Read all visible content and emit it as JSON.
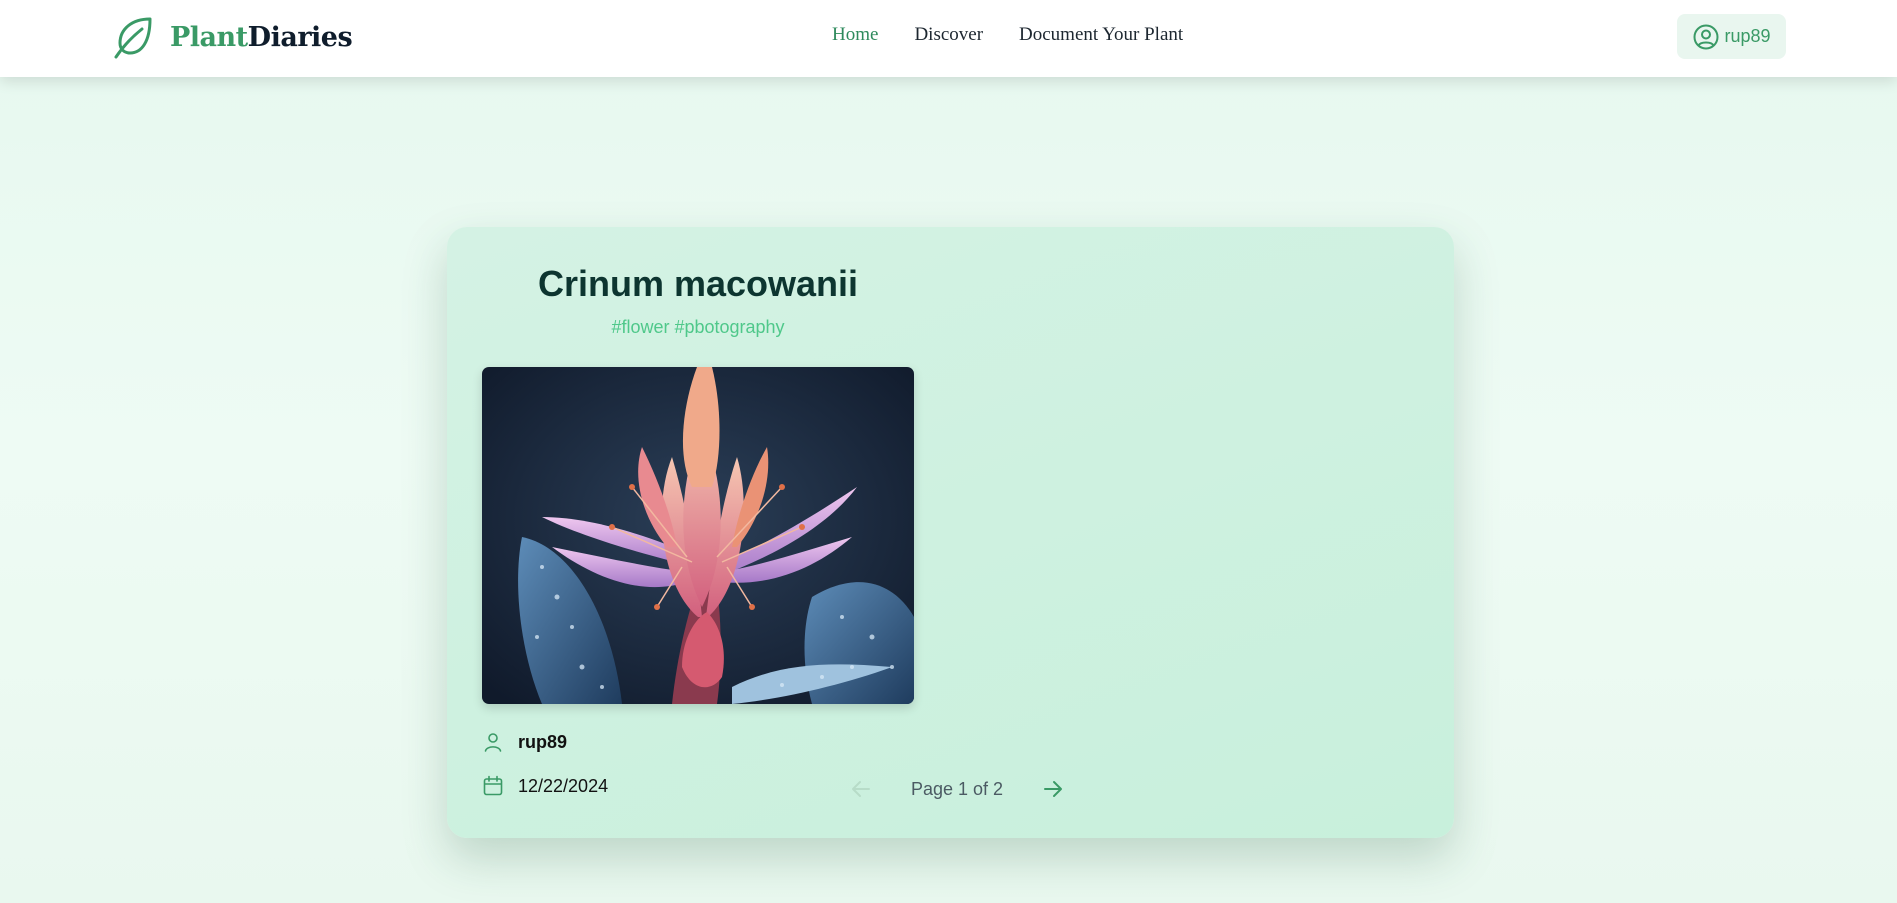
{
  "header": {
    "logo_part1": "Plant",
    "logo_part2": "Diaries",
    "logo_icon": "leaf-icon",
    "nav": [
      {
        "label": "Home",
        "active": true
      },
      {
        "label": "Discover",
        "active": false
      },
      {
        "label": "Document Your Plant",
        "active": false
      }
    ],
    "user": {
      "icon": "user-circle-icon",
      "name": "rup89"
    }
  },
  "post": {
    "title": "Crinum macowanii",
    "tags": "#flower #pbotography",
    "image_icon": "flower-photo",
    "author_icon": "user-icon",
    "author": "rup89",
    "date_icon": "calendar-icon",
    "date": "12/22/2024"
  },
  "pagination": {
    "label": "Page 1 of 2",
    "prev_icon": "arrow-left-icon",
    "next_icon": "arrow-right-icon",
    "prev_disabled": true
  },
  "colors": {
    "accent": "#3a9a66",
    "tag": "#4fc88a",
    "title": "#0d3530",
    "card": "#cdf1df"
  }
}
